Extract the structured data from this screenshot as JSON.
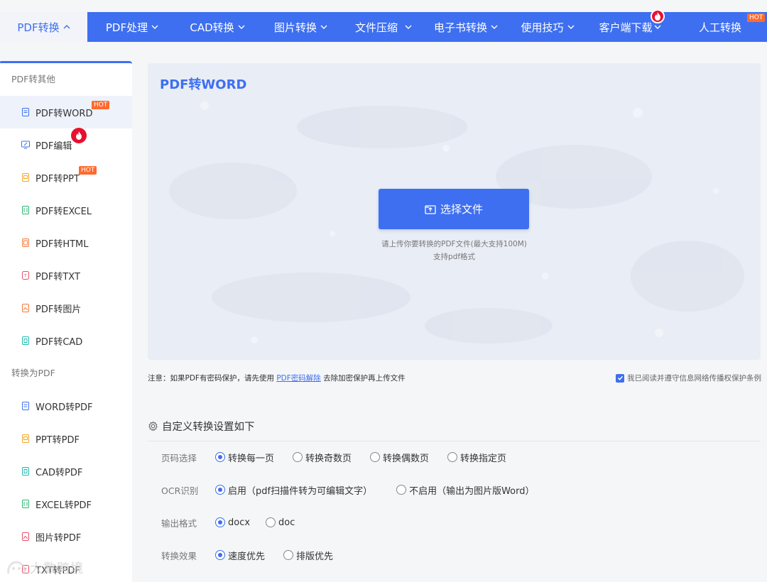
{
  "nav": {
    "items": [
      {
        "label": "PDF转换",
        "chevron": "^",
        "active": true
      },
      {
        "label": "PDF处理",
        "chevron": "⌄"
      },
      {
        "label": "CAD转换",
        "chevron": "⌄"
      },
      {
        "label": "图片转换",
        "chevron": "⌄"
      },
      {
        "label": "文件压缩",
        "chevron": "⌄"
      },
      {
        "label": "电子书转换",
        "chevron": "⌄"
      },
      {
        "label": "使用技巧",
        "chevron": "⌄"
      },
      {
        "label": "客户端下载",
        "chevron": "⌄",
        "badge": "fire-icon"
      },
      {
        "label": "人工转换",
        "badge": "HOT"
      }
    ]
  },
  "sidebar": {
    "group1": "PDF转其他",
    "group1_items": [
      {
        "label": "PDF转WORD",
        "badge": "HOT",
        "icon_color": "#3e6ff0"
      },
      {
        "label": "PDF编辑",
        "badge": "fire-icon",
        "icon_color": "#3e6ff0"
      },
      {
        "label": "PDF转PPT",
        "badge": "HOT",
        "icon_color": "#f5a623"
      },
      {
        "label": "PDF转EXCEL",
        "icon_color": "#2bb673"
      },
      {
        "label": "PDF转HTML",
        "icon_color": "#f5793b"
      },
      {
        "label": "PDF转TXT",
        "icon_color": "#e8506e"
      },
      {
        "label": "PDF转图片",
        "icon_color": "#f5793b"
      },
      {
        "label": "PDF转CAD",
        "icon_color": "#21b8b0"
      }
    ],
    "group2": "转换为PDF",
    "group2_items": [
      {
        "label": "WORD转PDF",
        "icon_color": "#3e6ff0"
      },
      {
        "label": "PPT转PDF",
        "icon_color": "#f5a623"
      },
      {
        "label": "CAD转PDF",
        "icon_color": "#21b8b0"
      },
      {
        "label": "EXCEL转PDF",
        "icon_color": "#2bb673"
      },
      {
        "label": "图片转PDF",
        "icon_color": "#e8506e"
      },
      {
        "label": "TXT转PDF",
        "icon_color": "#e8506e"
      }
    ]
  },
  "upload": {
    "title": "PDF转WORD",
    "button_label": "选择文件",
    "hint_line1": "请上传你要转换的PDF文件(最大支持100M)",
    "hint_line2": "支持pdf格式"
  },
  "notice": {
    "prefix": "注意：如果PDF有密码保护，请先使用",
    "link": "PDF密码解除",
    "suffix": "去除加密保护再上传文件"
  },
  "agree": {
    "label": "我已阅读并遵守信息网络传播权保护条例",
    "checked": true
  },
  "settings": {
    "title": "自定义转换设置如下",
    "rows": [
      {
        "label": "页码选择",
        "options": [
          "转换每一页",
          "转换奇数页",
          "转换偶数页",
          "转换指定页"
        ],
        "selected": 0
      },
      {
        "label": "OCR识别",
        "options": [
          "启用（pdf扫描件转为可编辑文字）",
          "不启用（输出为图片版Word）"
        ],
        "selected": 0
      },
      {
        "label": "输出格式",
        "options": [
          "docx",
          "doc"
        ],
        "selected": 0
      },
      {
        "label": "转换效果",
        "options": [
          "速度优先",
          "排版优先"
        ],
        "selected": 0
      }
    ]
  },
  "watermark": "大数跨境",
  "colors": {
    "accent": "#3e6ff0",
    "hot": "#ff6a2e",
    "fire": "#e8102f"
  }
}
